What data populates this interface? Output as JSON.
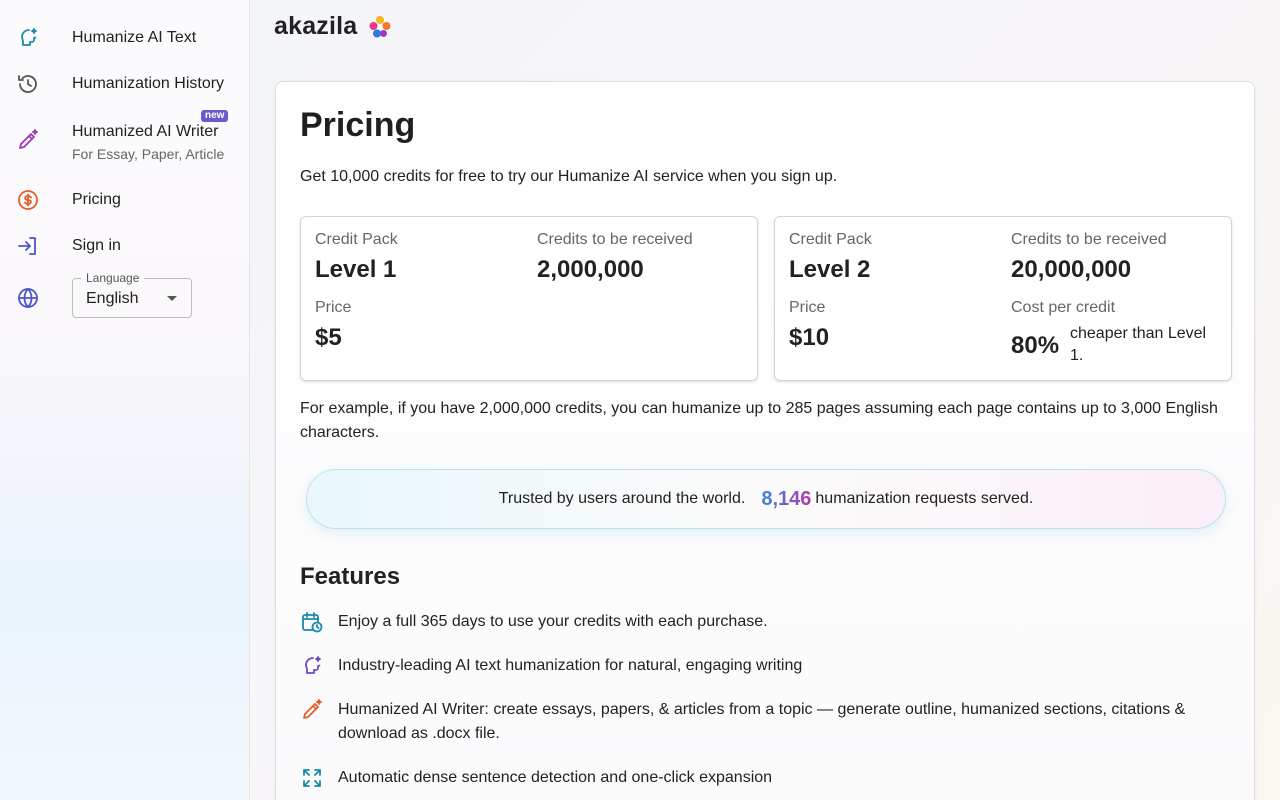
{
  "sidebar": {
    "items": [
      {
        "label": "Humanize AI Text"
      },
      {
        "label": "Humanization History"
      },
      {
        "label": "Humanized AI Writer",
        "sub": "For Essay, Paper, Article",
        "badge": "new"
      },
      {
        "label": "Pricing"
      },
      {
        "label": "Sign in"
      }
    ],
    "language": {
      "legend": "Language",
      "value": "English"
    }
  },
  "header": {
    "brand": "akazila"
  },
  "pricing": {
    "title": "Pricing",
    "intro": "Get 10,000 credits for free to try our Humanize AI service when you sign up.",
    "packs": [
      {
        "pack_label": "Credit Pack",
        "pack_value": "Level 1",
        "credits_label": "Credits to be received",
        "credits_value": "2,000,000",
        "price_label": "Price",
        "price_value": "$5"
      },
      {
        "pack_label": "Credit Pack",
        "pack_value": "Level 2",
        "credits_label": "Credits to be received",
        "credits_value": "20,000,000",
        "price_label": "Price",
        "price_value": "$10",
        "cost_label": "Cost per credit",
        "cost_pct": "80%",
        "cost_note": "cheaper than Level 1."
      }
    ],
    "example": "For example, if you have 2,000,000 credits, you can humanize up to 285 pages assuming each page contains up to 3,000 English characters.",
    "trusted": {
      "prefix": "Trusted by users around the world.",
      "count": "8,146",
      "suffix": "humanization requests served."
    }
  },
  "features": {
    "title": "Features",
    "items": [
      {
        "icon": "calendar-clock-icon",
        "text": "Enjoy a full 365 days to use your credits with each purchase."
      },
      {
        "icon": "ai-head-icon",
        "text": "Industry-leading AI text humanization for natural, engaging writing"
      },
      {
        "icon": "pen-sparkle-icon",
        "text": "Humanized AI Writer: create essays, papers, & articles from a topic — generate outline, humanized sections, citations & download as .docx file."
      },
      {
        "icon": "expand-icon",
        "text": "Automatic dense sentence detection and one-click expansion"
      }
    ]
  },
  "colors": {
    "accent_teal": "#1a8aa8",
    "accent_purple": "#8e3ab8",
    "accent_orange": "#e0602a",
    "accent_indigo": "#4a55c8"
  }
}
